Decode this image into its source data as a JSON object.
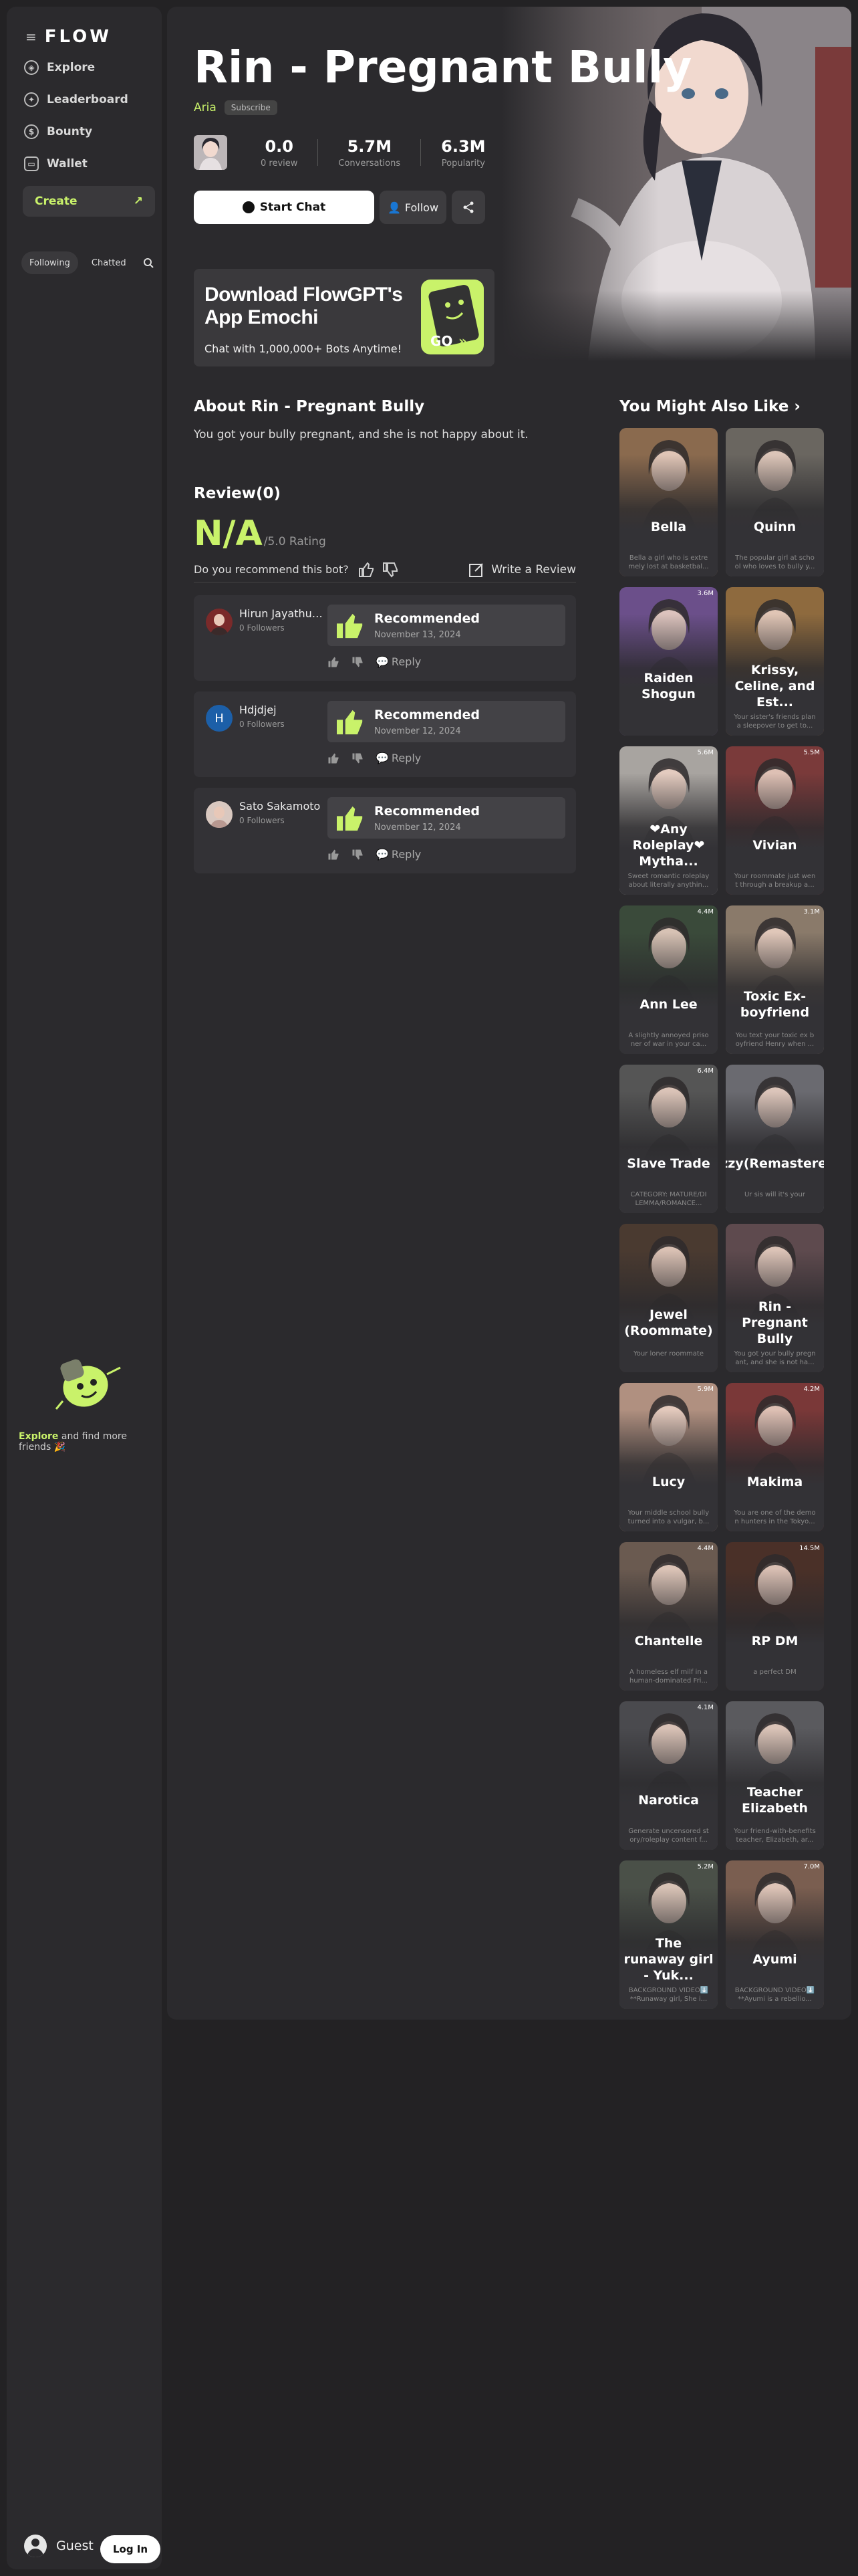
{
  "sidebar": {
    "logo": "FLOW",
    "nav": [
      {
        "label": "Explore",
        "icon": "compass-icon"
      },
      {
        "label": "Leaderboard",
        "icon": "medal-icon"
      },
      {
        "label": "Bounty",
        "icon": "dollar-icon"
      },
      {
        "label": "Wallet",
        "icon": "wallet-icon"
      }
    ],
    "create_label": "Create",
    "tabs": [
      "Following",
      "Chatted"
    ],
    "explore_word": "Explore",
    "explore_rest": " and find more friends 🎉",
    "guest_label": "Guest",
    "login_label": "Log In"
  },
  "bot": {
    "title": "Rin - Pregnant Bully",
    "author": "Aria",
    "subscribe_label": "Subscribe",
    "stats": [
      {
        "value": "0.0",
        "label": "0 review"
      },
      {
        "value": "5.7M",
        "label": "Conversations"
      },
      {
        "value": "6.3M",
        "label": "Popularity"
      }
    ],
    "start_chat_label": "Start Chat",
    "follow_label": "Follow"
  },
  "banner": {
    "title": "Download FlowGPT's App Emochi",
    "subtitle": "Chat with 1,000,000+ Bots Anytime!",
    "go_label": "GO"
  },
  "about": {
    "heading": "About Rin - Pregnant Bully",
    "text": "You got your bully pregnant, and she is not happy about it."
  },
  "reviews": {
    "heading": "Review(0)",
    "rating": "N/A",
    "rating_suffix": "/5.0 Rating",
    "recommend_question": "Do you recommend this bot?",
    "write_label": "Write a Review",
    "items": [
      {
        "name": "Hirun Jayathunga",
        "followers": "0 Followers",
        "verdict": "Recommended",
        "date": "November 13, 2024",
        "reply": "Reply",
        "avatar": "photo"
      },
      {
        "name": "Hdjdjej",
        "followers": "0 Followers",
        "verdict": "Recommended",
        "date": "November 12, 2024",
        "reply": "Reply",
        "avatar": "H"
      },
      {
        "name": "Sato Sakamoto",
        "followers": "0 Followers",
        "verdict": "Recommended",
        "date": "November 12, 2024",
        "reply": "Reply",
        "avatar": "photo"
      }
    ]
  },
  "similar": {
    "heading": "You Might Also Like",
    "cards": [
      {
        "name": "Bella",
        "count": "",
        "desc": "Bella a girl who is extre mely lost at basketbal...",
        "color": "#8a6a4e"
      },
      {
        "name": "Quinn",
        "count": "",
        "desc": "The popular girl at scho ol who loves to bully y...",
        "color": "#6a6660"
      },
      {
        "name": "Raiden Shogun",
        "count": "3.6M",
        "desc": "",
        "color": "#6b4f8a"
      },
      {
        "name": "Krissy, Celine, and Est...",
        "count": "",
        "desc": "Your sister's friends plan a sleepover to get to...",
        "color": "#8e6a3e"
      },
      {
        "name": "❤Any Roleplay❤ Mytha...",
        "count": "5.6M",
        "desc": "Sweet romantic roleplay about literally anythin...",
        "color": "#a8a4a0"
      },
      {
        "name": "Vivian",
        "count": "5.5M",
        "desc": "Your roommate just wen t through a breakup a...",
        "color": "#7a3a3a"
      },
      {
        "name": "Ann Lee",
        "count": "4.4M",
        "desc": "A slightly annoyed priso ner of war in your ca...",
        "color": "#3a4a3a"
      },
      {
        "name": "Toxic Ex-boyfriend",
        "count": "3.1M",
        "desc": "You text your toxic ex b oyfriend Henry when ...",
        "color": "#8a7a6a"
      },
      {
        "name": "Slave Trade",
        "count": "6.4M",
        "desc": "CATEGORY: MATURE/DI LEMMA/ROMANCE...",
        "color": "#555555"
      },
      {
        "name": "Lizzy(Remastered)",
        "count": "",
        "desc": "Ur sis will it's your",
        "color": "#6a6a70"
      },
      {
        "name": "Jewel (Roommate)",
        "count": "",
        "desc": "Your loner roommate",
        "color": "#4a3a30"
      },
      {
        "name": "Rin - Pregnant Bully",
        "count": "",
        "desc": "You got your bully pregn ant, and she is not ha...",
        "color": "#5e4a4e"
      },
      {
        "name": "Lucy",
        "count": "5.9M",
        "desc": "Your middle school bully turned into a vulgar, b...",
        "color": "#b09080"
      },
      {
        "name": "Makima",
        "count": "4.2M",
        "desc": "You are one of the demo n hunters in the Tokyo...",
        "color": "#7a3838"
      },
      {
        "name": "Chantelle",
        "count": "4.4M",
        "desc": "A homeless elf milf in a human-dominated Fri...",
        "color": "#6a5a50"
      },
      {
        "name": "RP DM",
        "count": "14.5M",
        "desc": "a perfect DM",
        "color": "#4a3028"
      },
      {
        "name": "Narotica",
        "count": "4.1M",
        "desc": "Generate uncensored st ory/roleplay content f...",
        "color": "#4a4a4e"
      },
      {
        "name": "Teacher Elizabeth",
        "count": "",
        "desc": "Your friend-with-benefits teacher, Elizabeth, ar...",
        "color": "#5a5a5e"
      },
      {
        "name": "The runaway girl - Yuk...",
        "count": "5.2M",
        "desc": "BACKGROUND VIDEO⬇️ **Runaway girl, She i...",
        "color": "#4a5048"
      },
      {
        "name": "Ayumi",
        "count": "7.0M",
        "desc": "BACKGROUND VIDEO⬇️ **Ayumi is a rebellio...",
        "color": "#7a5e50"
      }
    ]
  }
}
